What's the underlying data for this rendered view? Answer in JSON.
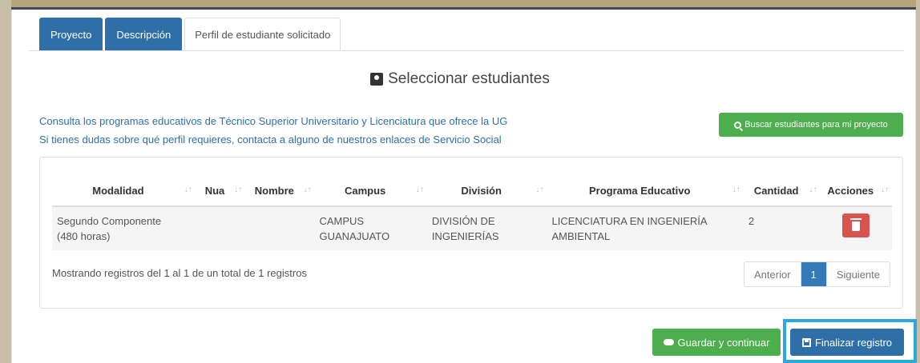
{
  "tabs": [
    {
      "label": "Proyecto"
    },
    {
      "label": "Descripción"
    },
    {
      "label": "Perfil de estudiante solicitado"
    }
  ],
  "section": {
    "title": "Seleccionar estudiantes",
    "icon": "user-card-icon"
  },
  "info": {
    "line1": "Consulta los programas educativos de Técnico Superior Universitario y Licenciatura que ofrece la UG",
    "line2": "Si tienes dudas sobre qué perfil requieres, contacta a alguno de nuestros enlaces de Servicio Social"
  },
  "search_button": {
    "label": "Buscar estudiantes para mi proyecto",
    "icon": "search-icon"
  },
  "table": {
    "columns": [
      "Modalidad",
      "Nua",
      "Nombre",
      "Campus",
      "División",
      "Programa Educativo",
      "Cantidad",
      "Acciones"
    ],
    "rows": [
      {
        "modalidad": "Segundo Componente",
        "modalidad_hours": "(480 horas)",
        "nua": "",
        "nombre": "",
        "campus": "CAMPUS GUANAJUATO",
        "division": "DIVISIÓN DE INGENIERÍAS",
        "programa": "LICENCIATURA EN INGENIERÍA AMBIENTAL",
        "cantidad": "2"
      }
    ]
  },
  "footer": {
    "showing": "Mostrando registros del 1 al 1 de un total de 1 registros",
    "pager": {
      "prev": "Anterior",
      "current": "1",
      "next": "Siguiente"
    }
  },
  "actions": {
    "save_label": "Guardar y continuar",
    "finish_label": "Finalizar registro"
  },
  "colors": {
    "primary": "#2f6fa8",
    "success": "#4cae4c",
    "danger": "#d9534f",
    "highlight": "#2aa9e0"
  }
}
